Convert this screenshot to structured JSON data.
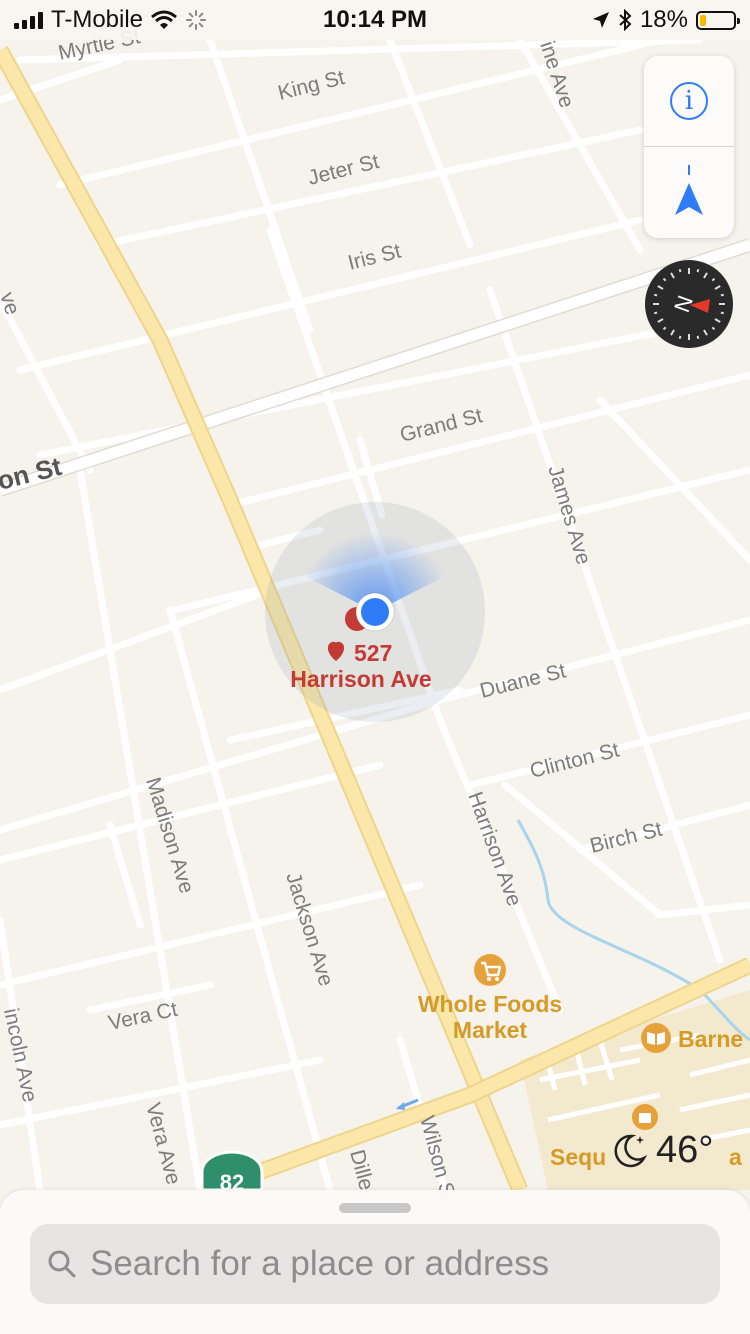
{
  "status_bar": {
    "carrier": "T-Mobile",
    "time": "10:14 PM",
    "battery": "18%",
    "battery_level": 0.18,
    "icons": [
      "signal-bars-icon",
      "wifi-icon",
      "activity-spinner-icon",
      "location-arrow-icon",
      "bluetooth-icon",
      "battery-icon"
    ]
  },
  "map": {
    "streets": {
      "myrtle": "Myrtle St",
      "king": "King St",
      "jeter": "Jeter St",
      "iris": "Iris St",
      "grand": "Grand St",
      "on_st": "on St",
      "duane": "Duane St",
      "clinton": "Clinton St",
      "birch": "Birch St",
      "james": "James Ave",
      "harrison": "Harrison Ave",
      "madison": "Madison Ave",
      "jackson": "Jackson Ave",
      "vera_ct": "Vera Ct",
      "vera_ave": "Vera Ave",
      "lincoln": "incoln Ave",
      "wilson": "Wilson St",
      "dille": "Dille",
      "vine": "ine Ave",
      "left_ave": "ve"
    },
    "favorite": {
      "line1": "527",
      "line2": "Harrison Ave",
      "icon": "heart-icon"
    },
    "pois": {
      "whole_foods_line1": "Whole Foods",
      "whole_foods_line2": "Market",
      "barnes": "Barne",
      "sequoia": "Sequ",
      "sequoia_tail": "a"
    },
    "route_shield": "82",
    "colors": {
      "land": "#f6f2ec",
      "minor_road": "#ffffff",
      "arterial": "#fbe7a9",
      "water": "#a8d4ec",
      "user_location": "#2f7cf6",
      "favorite": "#c33b35",
      "poi_orange": "#d69a26",
      "shield": "#2f8f6d"
    }
  },
  "controls": {
    "info_icon": "info-icon",
    "tracking_icon": "location-arrow-icon",
    "compass_letter": "N"
  },
  "weather": {
    "icon": "moon-stars-icon",
    "temperature": "46°"
  },
  "search": {
    "placeholder": "Search for a place or address",
    "value": ""
  }
}
